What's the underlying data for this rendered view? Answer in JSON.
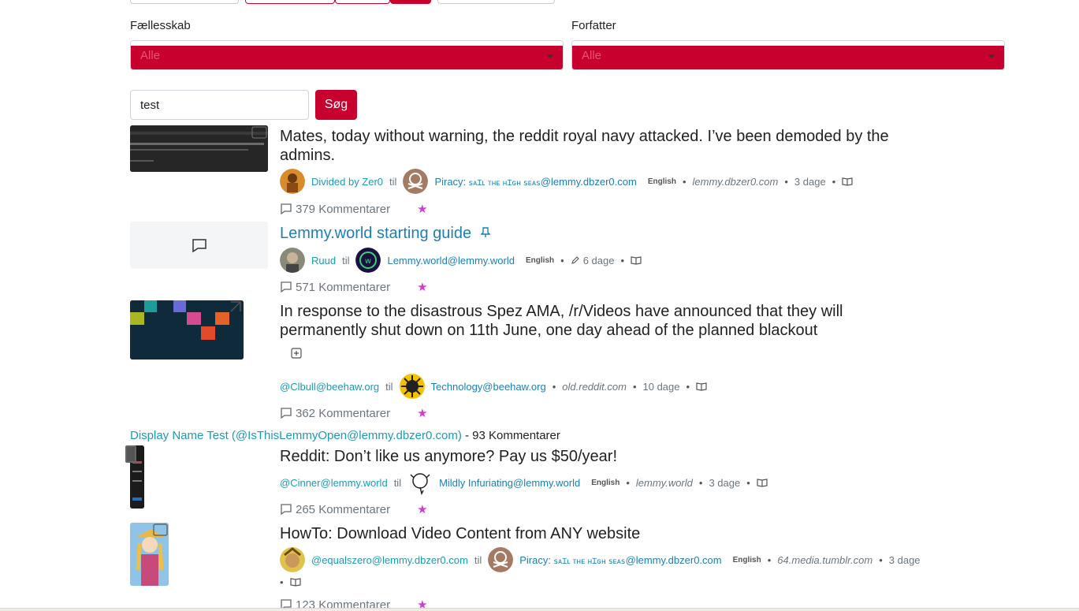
{
  "filters": {
    "community_label": "Fællesskab",
    "community_value": "Alle",
    "author_label": "Forfatter",
    "author_value": "Alle"
  },
  "search": {
    "value": "test",
    "button_label": "Søg"
  },
  "posts": [
    {
      "title": "Mates, today without warning, the reddit royal navy attacked. I’ve been demoded by the admins.",
      "author": "Divided by Zer0",
      "til": "til",
      "community_prefix": "Piracy: ",
      "community_sc": "ꜱᴀɪʟ ᴛʜᴇ ʜɪɢʜ ꜱᴇᴀꜱ",
      "community_suffix": "@lemmy.dbzer0.com",
      "language": "English",
      "domain": "lemmy.dbzer0.com",
      "age": "3 dage",
      "comments": "379 Kommentarer"
    },
    {
      "title": "Lemmy.world starting guide",
      "author": "Ruud",
      "til": "til",
      "community": "Lemmy.world@lemmy.world",
      "language": "English",
      "age": "6 dage",
      "comments": "571 Kommentarer"
    },
    {
      "title": "In response to the disastrous Spez AMA, /r/Videos have announced that they will permanently shut down on 11th June, one day ahead of the planned blackout",
      "author": "@Clbull@beehaw.org",
      "til": "til",
      "community": "Technology@beehaw.org",
      "domain": "old.reddit.com",
      "age": "10 dage",
      "comments": "362 Kommentarer"
    },
    {
      "title": "Reddit: Don’t like us anymore? Pay us $50/year!",
      "author": "@Cinner@lemmy.world",
      "til": "til",
      "community": "Mildly Infuriating@lemmy.world",
      "language": "English",
      "domain": "lemmy.world",
      "age": "3 dage",
      "comments": "265 Kommentarer"
    },
    {
      "title": "HowTo: Download Video Content from ANY website",
      "author": "@equalszero@lemmy.dbzer0.com",
      "til": "til",
      "community_prefix": "Piracy: ",
      "community_sc": "ꜱᴀɪʟ ᴛʜᴇ ʜɪɢʜ ꜱᴇᴀꜱ",
      "community_suffix": "@lemmy.dbzer0.com",
      "language": "English",
      "domain": "64.media.tumblr.com",
      "age": "3 dage",
      "comments": "123 Kommentarer"
    }
  ],
  "crosspost": {
    "link": "Display Name Test (@IsThisLemmyOpen@lemmy.dbzer0.com)",
    "rest": " - 93 Kommentarer"
  },
  "icons": {
    "comment": "comment-icon",
    "reader": "book-open-icon",
    "pin": "pin-icon",
    "edit": "pencil-icon",
    "expand": "plus-square-icon",
    "star": "star-icon"
  },
  "colors": {
    "accent": "#c8002d",
    "link": "#1d7fb8",
    "user": "#1d9ab8"
  }
}
